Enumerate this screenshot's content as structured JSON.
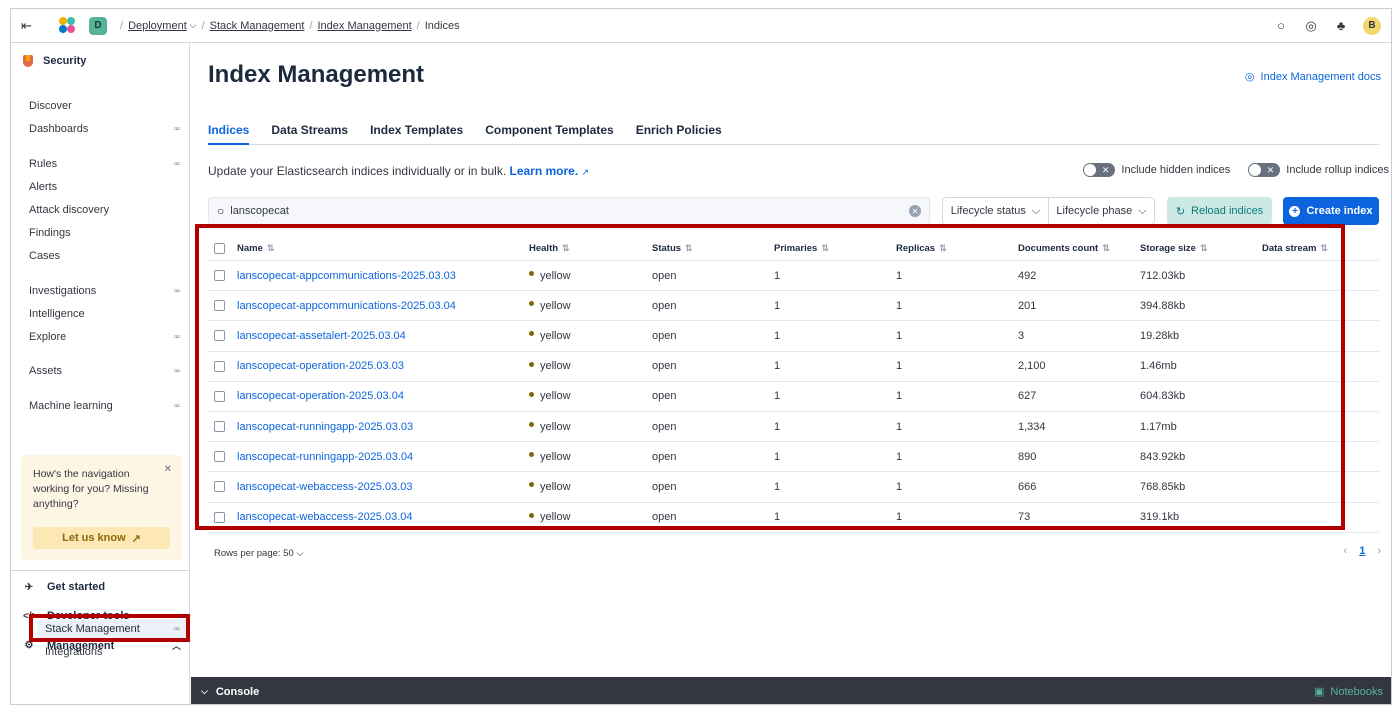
{
  "header": {
    "collapse_icon": "menu-collapse-icon",
    "space_initial": "D",
    "breadcrumbs": [
      "Deployment",
      "Stack Management",
      "Index Management",
      "Indices"
    ],
    "user_initial": "B"
  },
  "sidebar": {
    "title": "Security",
    "items": [
      {
        "label": "Discover",
        "grid": false
      },
      {
        "label": "Dashboards",
        "grid": true
      },
      {
        "label": "Rules",
        "grid": true
      },
      {
        "label": "Alerts",
        "grid": false
      },
      {
        "label": "Attack discovery",
        "grid": false
      },
      {
        "label": "Findings",
        "grid": false
      },
      {
        "label": "Cases",
        "grid": false
      },
      {
        "label": "Investigations",
        "grid": true
      },
      {
        "label": "Intelligence",
        "grid": false
      },
      {
        "label": "Explore",
        "grid": true
      },
      {
        "label": "Assets",
        "grid": true
      },
      {
        "label": "Machine learning",
        "grid": true
      }
    ],
    "callout": {
      "text": "How's the navigation working for you? Missing anything?",
      "button": "Let us know"
    },
    "bottom": {
      "get_started": "Get started",
      "developer_tools": "Developer tools",
      "management": "Management",
      "stack_management": "Stack Management",
      "integrations": "Integrations"
    }
  },
  "main": {
    "title": "Index Management",
    "docs_link": "Index Management docs",
    "tabs": [
      "Indices",
      "Data Streams",
      "Index Templates",
      "Component Templates",
      "Enrich Policies"
    ],
    "description": "Update your Elasticsearch indices individually or in bulk.",
    "learn_more": "Learn more.",
    "toggle_hidden": "Include hidden indices",
    "toggle_rollup": "Include rollup indices",
    "search_value": "lanscopecat",
    "filter_lifecycle_status": "Lifecycle status",
    "filter_lifecycle_phase": "Lifecycle phase",
    "reload_button": "Reload indices",
    "create_button": "Create index",
    "columns": [
      "Name",
      "Health",
      "Status",
      "Primaries",
      "Replicas",
      "Documents count",
      "Storage size",
      "Data stream"
    ],
    "rows": [
      {
        "name": "lanscopecat-appcommunications-2025.03.03",
        "health": "yellow",
        "status": "open",
        "primaries": "1",
        "replicas": "1",
        "docs": "492",
        "size": "712.03kb",
        "stream": ""
      },
      {
        "name": "lanscopecat-appcommunications-2025.03.04",
        "health": "yellow",
        "status": "open",
        "primaries": "1",
        "replicas": "1",
        "docs": "201",
        "size": "394.88kb",
        "stream": ""
      },
      {
        "name": "lanscopecat-assetalert-2025.03.04",
        "health": "yellow",
        "status": "open",
        "primaries": "1",
        "replicas": "1",
        "docs": "3",
        "size": "19.28kb",
        "stream": ""
      },
      {
        "name": "lanscopecat-operation-2025.03.03",
        "health": "yellow",
        "status": "open",
        "primaries": "1",
        "replicas": "1",
        "docs": "2,100",
        "size": "1.46mb",
        "stream": ""
      },
      {
        "name": "lanscopecat-operation-2025.03.04",
        "health": "yellow",
        "status": "open",
        "primaries": "1",
        "replicas": "1",
        "docs": "627",
        "size": "604.83kb",
        "stream": ""
      },
      {
        "name": "lanscopecat-runningapp-2025.03.03",
        "health": "yellow",
        "status": "open",
        "primaries": "1",
        "replicas": "1",
        "docs": "1,334",
        "size": "1.17mb",
        "stream": ""
      },
      {
        "name": "lanscopecat-runningapp-2025.03.04",
        "health": "yellow",
        "status": "open",
        "primaries": "1",
        "replicas": "1",
        "docs": "890",
        "size": "843.92kb",
        "stream": ""
      },
      {
        "name": "lanscopecat-webaccess-2025.03.03",
        "health": "yellow",
        "status": "open",
        "primaries": "1",
        "replicas": "1",
        "docs": "666",
        "size": "768.85kb",
        "stream": ""
      },
      {
        "name": "lanscopecat-webaccess-2025.03.04",
        "health": "yellow",
        "status": "open",
        "primaries": "1",
        "replicas": "1",
        "docs": "73",
        "size": "319.1kb",
        "stream": ""
      }
    ],
    "rows_per_page": "Rows per page: 50",
    "current_page": "1"
  },
  "console": {
    "label": "Console",
    "notebooks": "Notebooks"
  },
  "colors": {
    "accent": "#0b64dd",
    "highlight_border": "#b20000",
    "health_yellow": "#7b6a0b"
  }
}
